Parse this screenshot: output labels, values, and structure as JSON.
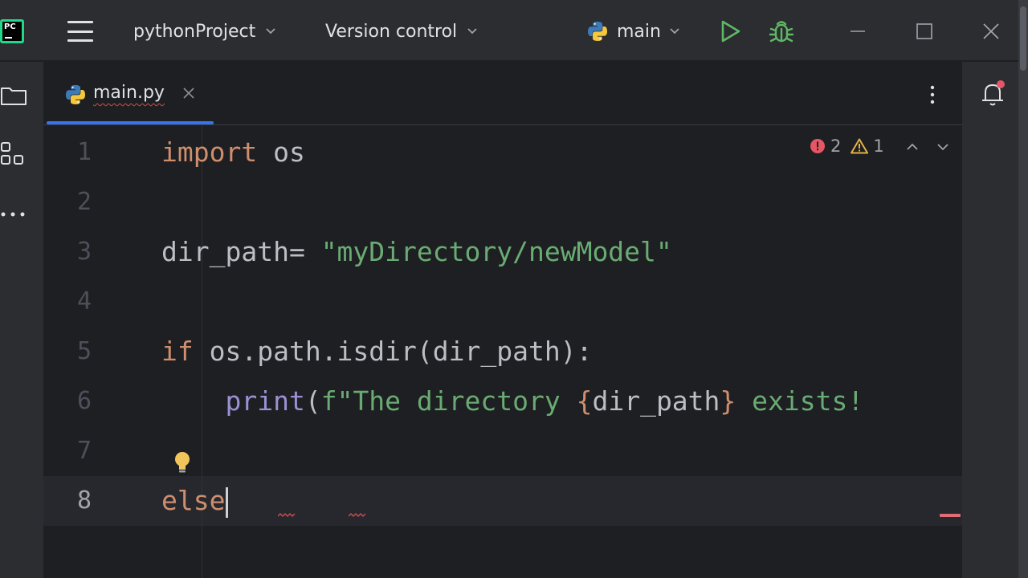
{
  "app": {
    "logo_text": "PC"
  },
  "titlebar": {
    "project_name": "pythonProject",
    "vcs_label": "Version control",
    "run_config": "main"
  },
  "tabs": [
    {
      "label": "main.py"
    }
  ],
  "inspections": {
    "errors": "2",
    "warnings": "1"
  },
  "editor": {
    "line_numbers": [
      "1",
      "2",
      "3",
      "4",
      "5",
      "6",
      "7",
      "8"
    ],
    "lines": {
      "l1_kw": "import",
      "l1_rest": " os",
      "l3_var": "dir_path= ",
      "l3_str": "\"myDirectory/newModel\"",
      "l5_kw": "if",
      "l5_rest": " os.path.isdir(dir_path):",
      "l6_indent": "    ",
      "l6_fn": "print",
      "l6_paren": "(",
      "l6_str1": "f\"The directory ",
      "l6_brace_open": "{",
      "l6_var": "dir_path",
      "l6_brace_close": "}",
      "l6_str2": " exists!",
      "l8_kw": "else"
    }
  },
  "colors": {
    "accent": "#3574f0",
    "keyword": "#cf8e6d",
    "string": "#6aab73",
    "function": "#9c8fd4",
    "error": "#e55765",
    "warning": "#e3b341",
    "run": "#5fb865"
  }
}
